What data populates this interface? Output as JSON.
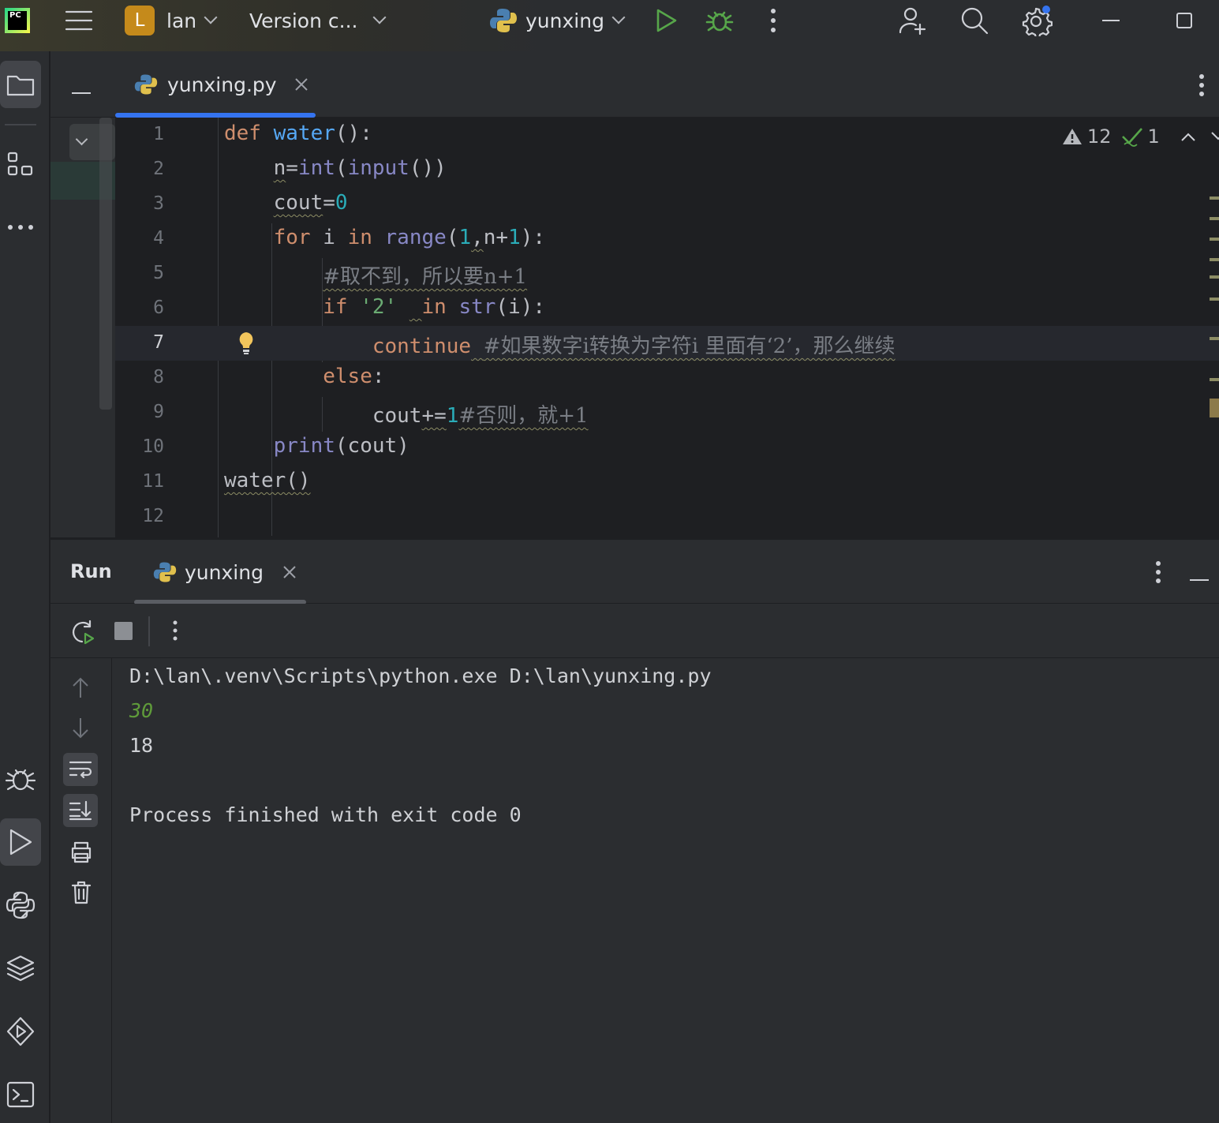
{
  "titlebar": {
    "app_logo": "PC",
    "project_badge": "L",
    "project_name": "lan",
    "vcs_label": "Version c...",
    "run_config": "yunxing"
  },
  "editor": {
    "tab_label": "yunxing.py",
    "inspection": {
      "warnings": "12",
      "ok": "1"
    },
    "current_line": 7,
    "lines": [
      {
        "n": "1",
        "code": "def water():"
      },
      {
        "n": "2",
        "code": "    n=int(input())"
      },
      {
        "n": "3",
        "code": "    cout=0"
      },
      {
        "n": "4",
        "code": "    for i in range(1,n+1):"
      },
      {
        "n": "5",
        "code": "        #取不到，所以要n+1"
      },
      {
        "n": "6",
        "code": "        if '2'  in str(i):"
      },
      {
        "n": "7",
        "code": "            continue #如果数字i转换为字符i 里面有‘2’，那么继续"
      },
      {
        "n": "8",
        "code": "        else:"
      },
      {
        "n": "9",
        "code": "            cout+=1#否则，就+1"
      },
      {
        "n": "10",
        "code": "    print(cout)"
      },
      {
        "n": "11",
        "code": "water()"
      },
      {
        "n": "12",
        "code": ""
      }
    ]
  },
  "run": {
    "title": "Run",
    "tab_label": "yunxing",
    "output": [
      {
        "text": "D:\\lan\\.venv\\Scripts\\python.exe D:\\lan\\yunxing.py",
        "kind": "cmd"
      },
      {
        "text": "30",
        "kind": "input"
      },
      {
        "text": "18",
        "kind": "stdout"
      },
      {
        "text": "",
        "kind": "blank"
      },
      {
        "text": "Process finished with exit code 0",
        "kind": "stdout"
      }
    ]
  },
  "colors": {
    "keyword": "#cf8e6d",
    "function": "#56a8f5",
    "builtin": "#8888c6",
    "number": "#2aacb8",
    "string": "#6aab73",
    "comment": "#7a7e85",
    "input_echo": "#5f9b3a",
    "accent": "#3574f0"
  }
}
